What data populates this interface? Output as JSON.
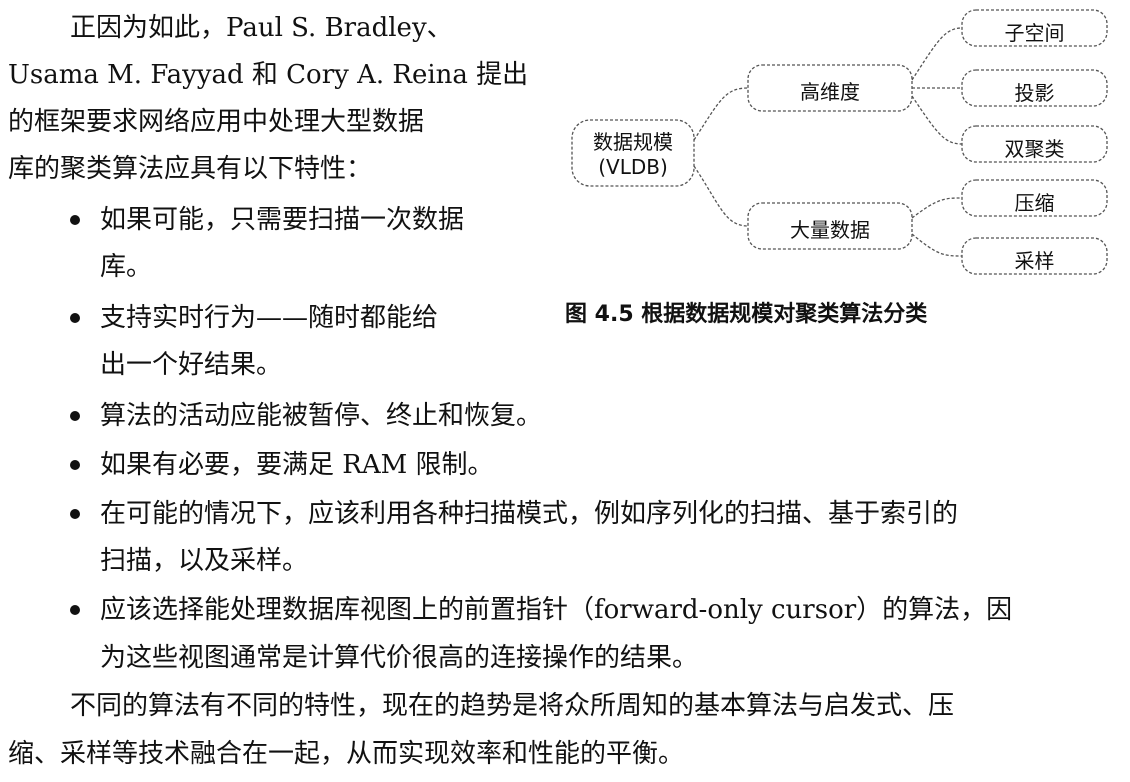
{
  "intro_lines": [
    "正因为如此，Paul  S.  Bradley、",
    "Usama M. Fayyad 和 Cory A. Reina 提出",
    "的框架要求网络应用中处理大型数据",
    "库的聚类算法应具有以下特性："
  ],
  "bullets": [
    [
      "如果可能，只需要扫描一次数据",
      "库。"
    ],
    [
      "支持实时行为——随时都能给",
      "出一个好结果。"
    ],
    [
      "算法的活动应能被暂停、终止和恢复。"
    ],
    [
      "如果有必要，要满足 RAM 限制。"
    ],
    [
      "在可能的情况下，应该利用各种扫描模式，例如序列化的扫描、基于索引的",
      "扫描，以及采样。"
    ],
    [
      "应该选择能处理数据库视图上的前置指针（forward-only cursor）的算法，因",
      "为这些视图通常是计算代价很高的连接操作的结果。"
    ]
  ],
  "closing_lines": [
    "不同的算法有不同的特性，现在的趋势是将众所周知的基本算法与启发式、压",
    "缩、采样等技术融合在一起，从而实现效率和性能的平衡。"
  ],
  "figure": {
    "root": [
      "数据规模",
      "(VLDB)"
    ],
    "mid": [
      "高维度",
      "大量数据"
    ],
    "leaves_high_dim": [
      "子空间",
      "投影",
      "双聚类"
    ],
    "leaves_large_data": [
      "压缩",
      "采样"
    ],
    "caption": "图 4.5    根据数据规模对聚类算法分类"
  }
}
